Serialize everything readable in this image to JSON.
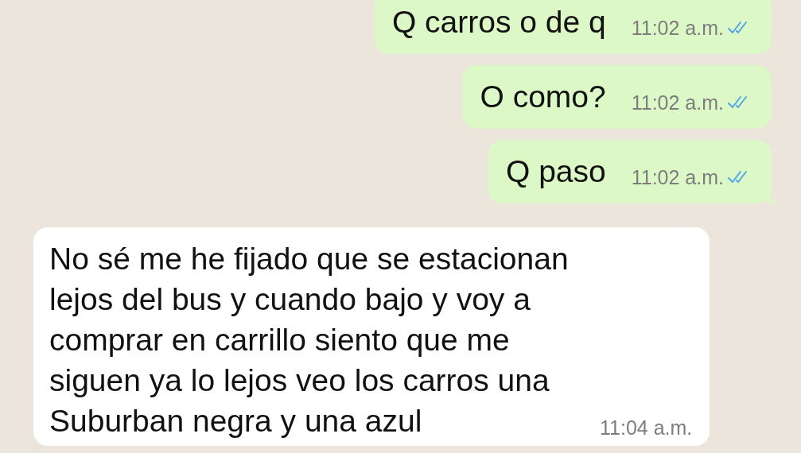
{
  "messages": [
    {
      "kind": "out",
      "text": "Q carros o de q",
      "time": "11:02 a.m.",
      "read": true,
      "tail": false
    },
    {
      "kind": "out",
      "text": "O como?",
      "time": "11:02 a.m.",
      "read": true,
      "tail": false
    },
    {
      "kind": "out",
      "text": "Q paso",
      "time": "11:02 a.m.",
      "read": true,
      "tail": true
    },
    {
      "kind": "in",
      "text": "No sé me he fijado que se estacionan lejos del bus y cuando bajo y voy a comprar en carrillo siento que me siguen ya lo lejos veo los carros una Suburban negra y una azul",
      "time": "11:04 a.m.",
      "tail": false
    }
  ]
}
